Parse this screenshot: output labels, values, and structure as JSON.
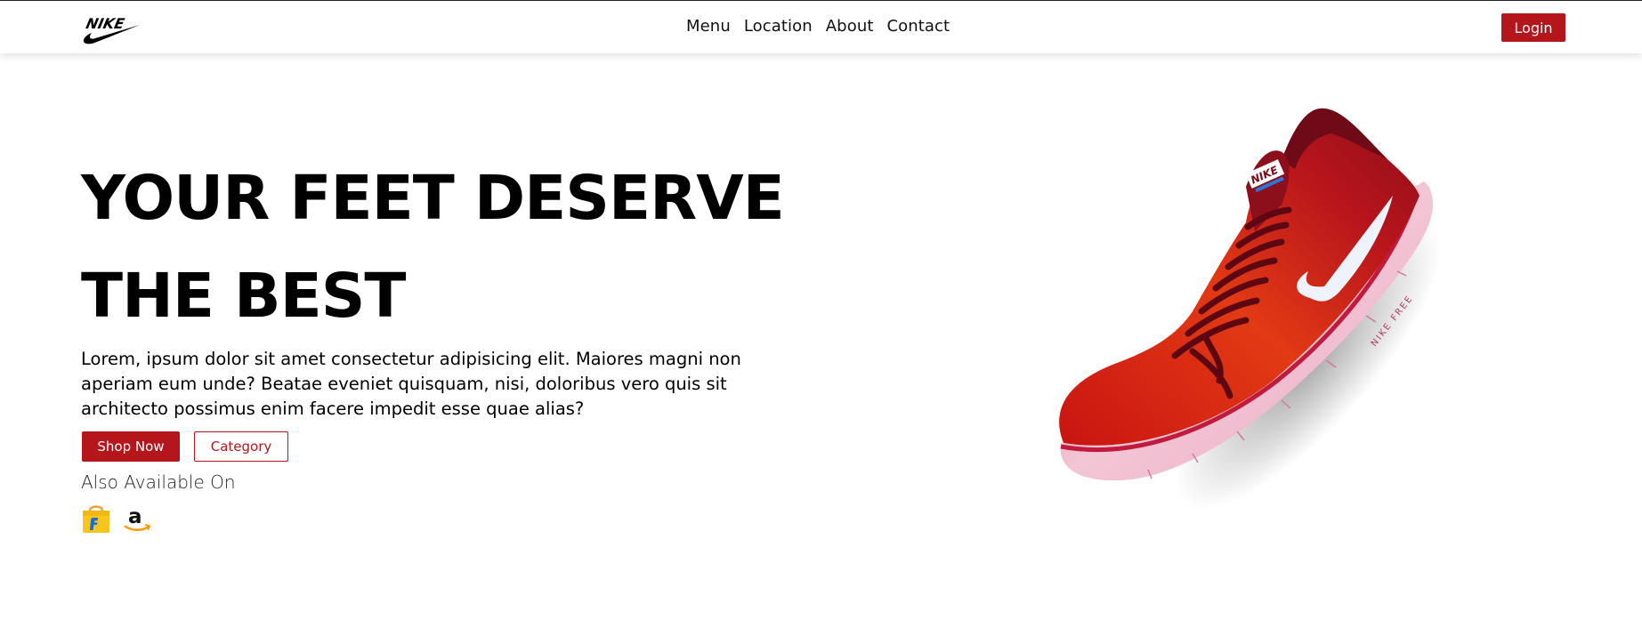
{
  "header": {
    "brand": "NIKE",
    "nav": [
      "Menu",
      "Location",
      "About",
      "Contact"
    ],
    "login_label": "Login"
  },
  "hero": {
    "title_line1": "YOUR FEET DESERVE",
    "title_line2": "THE BEST",
    "description": "Lorem, ipsum dolor sit amet consectetur adipisicing elit. Maiores magni non aperiam eum unde? Beatae eveniet quisquam, nisi, doloribus vero quis sit architecto possimus enim facere impedit esse quae alias?",
    "shop_now_label": "Shop Now",
    "category_label": "Category",
    "also_available": "Also Available On",
    "stores": [
      "flipkart-icon",
      "amazon-icon"
    ]
  },
  "product": {
    "image": "red-nike-running-shoe",
    "shoe_brand_text": "NIKE",
    "sole_text": "NIKE FREE"
  },
  "colors": {
    "accent": "#b5161b",
    "text": "#000000",
    "background": "#ffffff"
  }
}
